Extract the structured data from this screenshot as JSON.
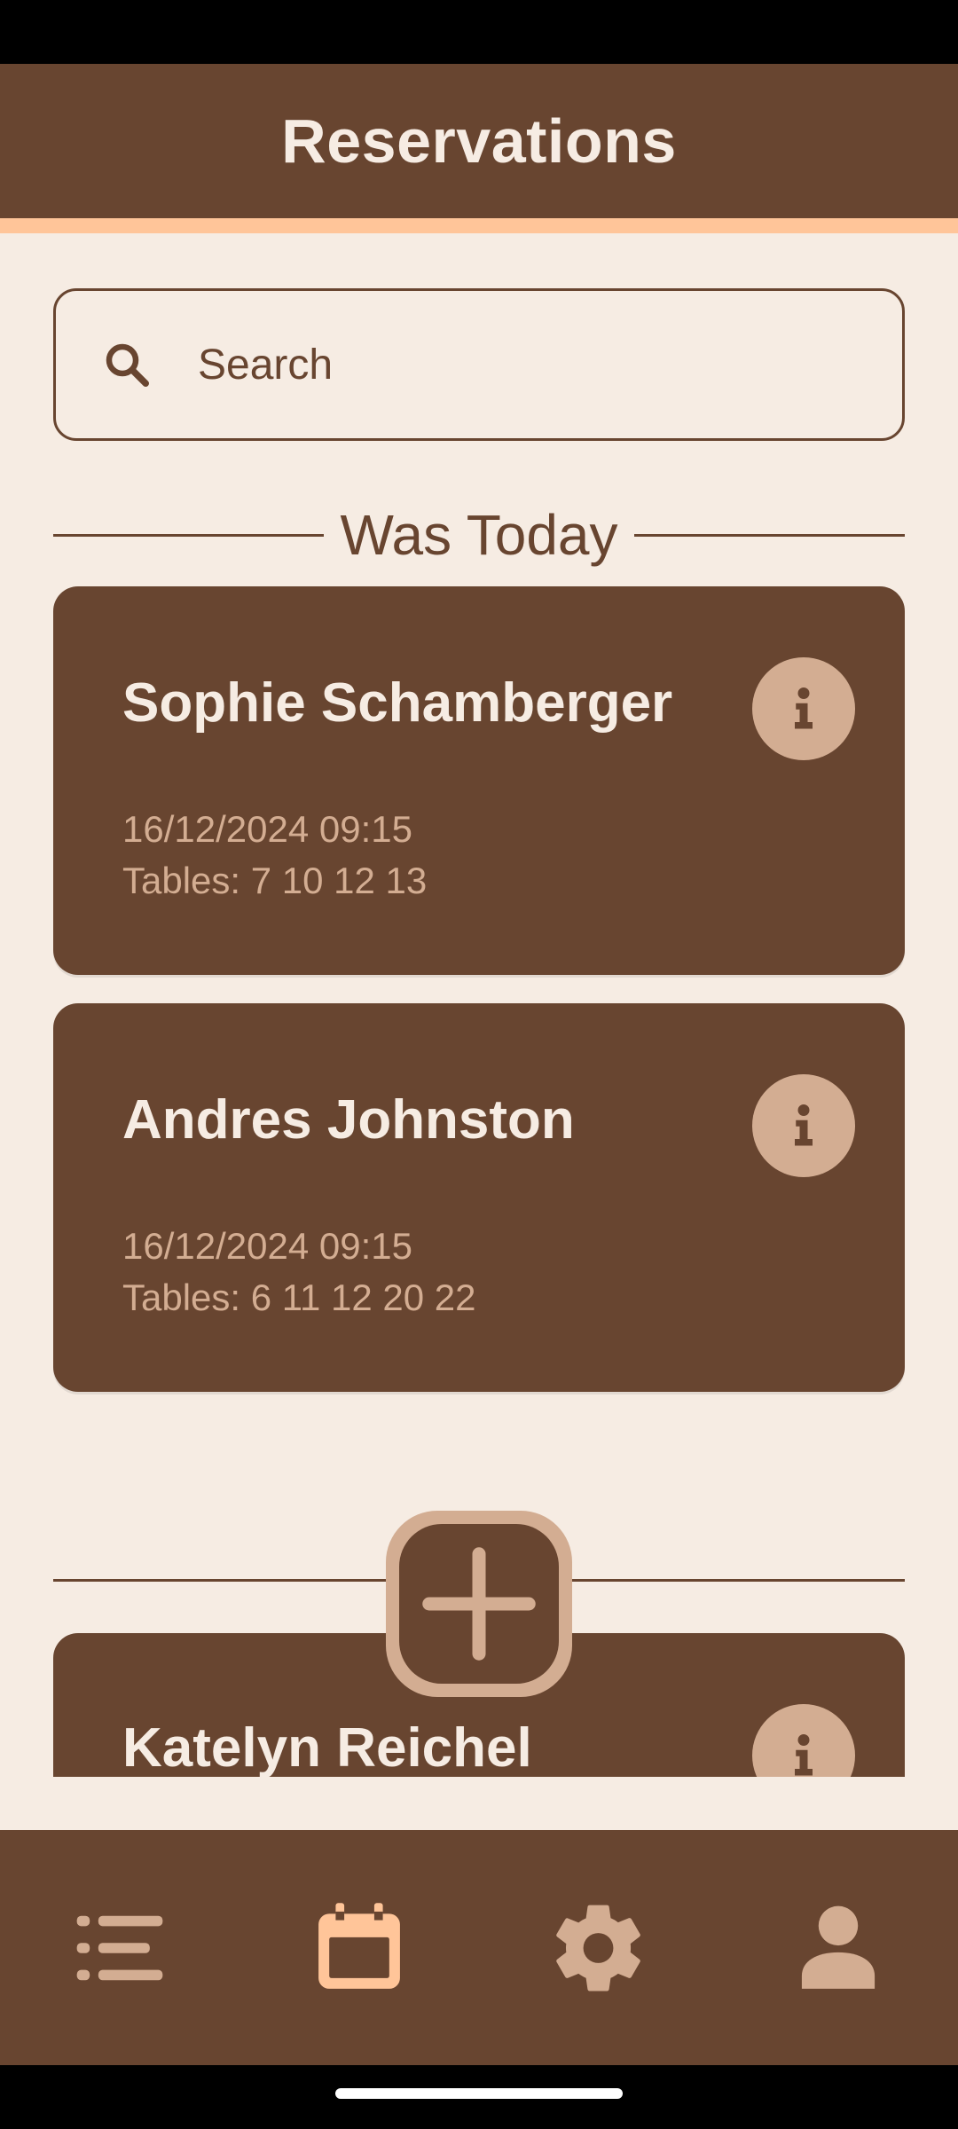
{
  "app_bar": {
    "title": "Reservations"
  },
  "search": {
    "placeholder": "Search"
  },
  "sections": [
    {
      "label": "Was Today",
      "reservations": [
        {
          "name": "Sophie Schamberger",
          "datetime": "16/12/2024 09:15",
          "tables": "Tables: 7 10 12 13"
        },
        {
          "name": "Andres Johnston",
          "datetime": "16/12/2024 09:15",
          "tables": "Tables: 6 11 12 20 22"
        }
      ]
    },
    {
      "label": "",
      "reservations": [
        {
          "name": "Katelyn Reichel",
          "datetime": "",
          "tables": ""
        }
      ]
    }
  ],
  "icons": {
    "search": "search-icon",
    "info": "info-icon",
    "add": "plus-icon",
    "nav": [
      "list-icon",
      "calendar-icon",
      "gear-icon",
      "person-icon"
    ]
  },
  "bottom_nav": {
    "active_index": 1
  },
  "colors": {
    "brown": "#684530",
    "cream": "#f6ece3",
    "peach": "#ffc599",
    "tan": "#d3ad92"
  }
}
